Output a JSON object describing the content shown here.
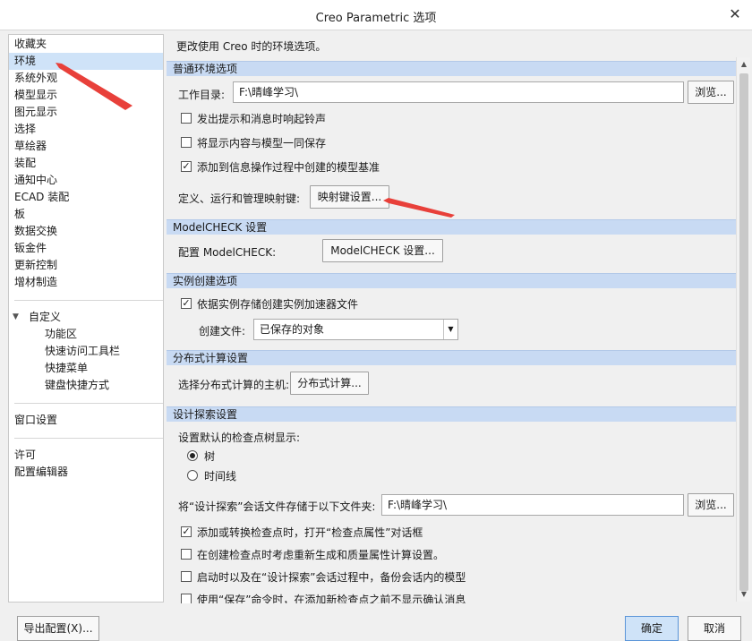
{
  "window": {
    "title": "Creo Parametric 选项",
    "close": "✕"
  },
  "sidebar": {
    "items": [
      "收藏夹",
      "环境",
      "系统外观",
      "模型显示",
      "图元显示",
      "选择",
      "草绘器",
      "装配",
      "通知中心",
      "ECAD 装配",
      "板",
      "数据交换",
      "钣金件",
      "更新控制",
      "增材制造"
    ],
    "selected": "环境",
    "customize": {
      "label": "自定义",
      "children": [
        "功能区",
        "快速访问工具栏",
        "快捷菜单",
        "键盘快捷方式"
      ]
    },
    "window_settings": "窗口设置",
    "license": "许可",
    "config_editor": "配置编辑器"
  },
  "content": {
    "description": "更改使用 Creo 时的环境选项。",
    "general": {
      "header": "普通环境选项",
      "workdir_label": "工作目录:",
      "workdir_value": "F:\\晴峰学习\\",
      "browse": "浏览...",
      "opt_bell": "发出提示和消息时响起铃声",
      "opt_bell_checked": false,
      "opt_save_display": "将显示内容与模型一同保存",
      "opt_save_display_checked": false,
      "opt_add_datums": "添加到信息操作过程中创建的模型基准",
      "opt_add_datums_checked": true,
      "mapkey_label": "定义、运行和管理映射键:",
      "mapkey_button": "映射键设置..."
    },
    "modelcheck": {
      "header": "ModelCHECK 设置",
      "label": "配置 ModelCHECK:",
      "button": "ModelCHECK 设置..."
    },
    "instance": {
      "header": "实例创建选项",
      "opt_accel": "依据实例存储创建实例加速器文件",
      "opt_accel_checked": true,
      "create_file_label": "创建文件:",
      "create_file_value": "已保存的对象"
    },
    "distributed": {
      "header": "分布式计算设置",
      "label": "选择分布式计算的主机:",
      "button": "分布式计算..."
    },
    "design_explore": {
      "header": "设计探索设置",
      "tree_label": "设置默认的检查点树显示:",
      "radio_tree": "树",
      "radio_timeline": "时间线",
      "selected": "树",
      "store_label": "将“设计探索”会话文件存储于以下文件夹:",
      "store_value": "F:\\晴峰学习\\",
      "browse": "浏览...",
      "opt_open_props": "添加或转换检查点时，打开“检查点属性”对话框",
      "opt_open_props_checked": true,
      "opt_regen": "在创建检查点时考虑重新生成和质量属性计算设置。",
      "opt_regen_checked": false,
      "opt_backup": "启动时以及在“设计探索”会话过程中，备份会话内的模型",
      "opt_backup_checked": false,
      "opt_no_confirm": "使用“保存”命令时，在添加新检查点之前不显示确认消息",
      "opt_no_confirm_checked": false
    }
  },
  "footer": {
    "export": "导出配置(X)...",
    "ok": "确定",
    "cancel": "取消"
  },
  "colors": {
    "section_bg": "#c8daf3",
    "selected_bg": "#cfe3f8",
    "annotation_arrow": "#e8403a"
  }
}
